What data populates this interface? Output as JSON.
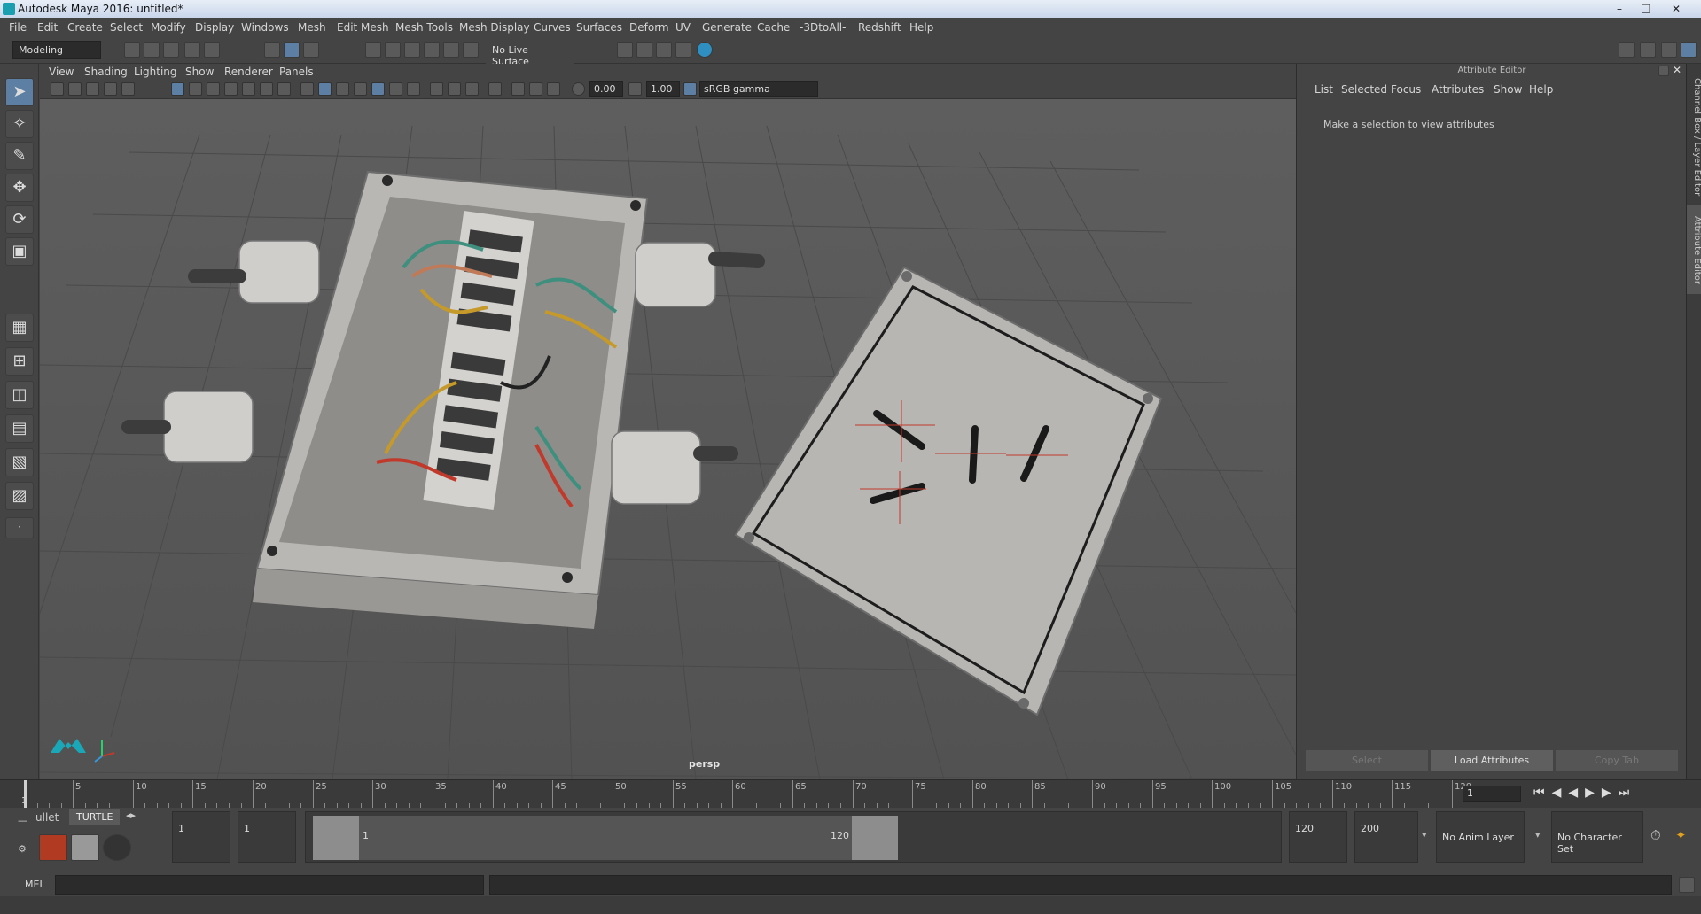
{
  "window": {
    "title": "Autodesk Maya 2016: untitled*"
  },
  "menubar": [
    "File",
    "Edit",
    "Create",
    "Select",
    "Modify",
    "Display",
    "Windows",
    "Mesh",
    "Edit Mesh",
    "Mesh Tools",
    "Mesh Display",
    "Curves",
    "Surfaces",
    "Deform",
    "UV",
    "Generate",
    "Cache",
    "-3DtoAll-",
    "Redshift",
    "Help"
  ],
  "toolbar": {
    "mode": "Modeling",
    "live_surface": "No Live Surface"
  },
  "panel_menu": [
    "View",
    "Shading",
    "Lighting",
    "Show",
    "Renderer",
    "Panels"
  ],
  "panel_tools": {
    "exposure": "0.00",
    "gamma": "1.00",
    "color_space": "sRGB gamma"
  },
  "viewport": {
    "camera": "persp"
  },
  "attribute_editor": {
    "title": "Attribute Editor",
    "menu": [
      "List",
      "Selected",
      "Focus",
      "Attributes",
      "Show",
      "Help"
    ],
    "message": "Make a selection to view attributes",
    "buttons": [
      "Select",
      "Load Attributes",
      "Copy Tab"
    ]
  },
  "side_tabs": [
    "Channel Box / Layer Editor",
    "Attribute Editor"
  ],
  "timeline": {
    "ticks": [
      "5",
      "10",
      "15",
      "20",
      "25",
      "30",
      "35",
      "40",
      "45",
      "50",
      "55",
      "60",
      "65",
      "70",
      "75",
      "80",
      "85",
      "90",
      "95",
      "100",
      "105",
      "110",
      "115",
      "120"
    ],
    "start_label": "1",
    "current_frame": "1"
  },
  "shelf": {
    "tabs": [
      "ullet",
      "TURTLE"
    ]
  },
  "range": {
    "start": "1",
    "playback_start": "1",
    "slider_start": "1",
    "slider_end": "120",
    "playback_end": "120",
    "end": "200",
    "anim_layer": "No Anim Layer",
    "character_set": "No Character Set"
  },
  "cmdline": {
    "label": "MEL"
  }
}
